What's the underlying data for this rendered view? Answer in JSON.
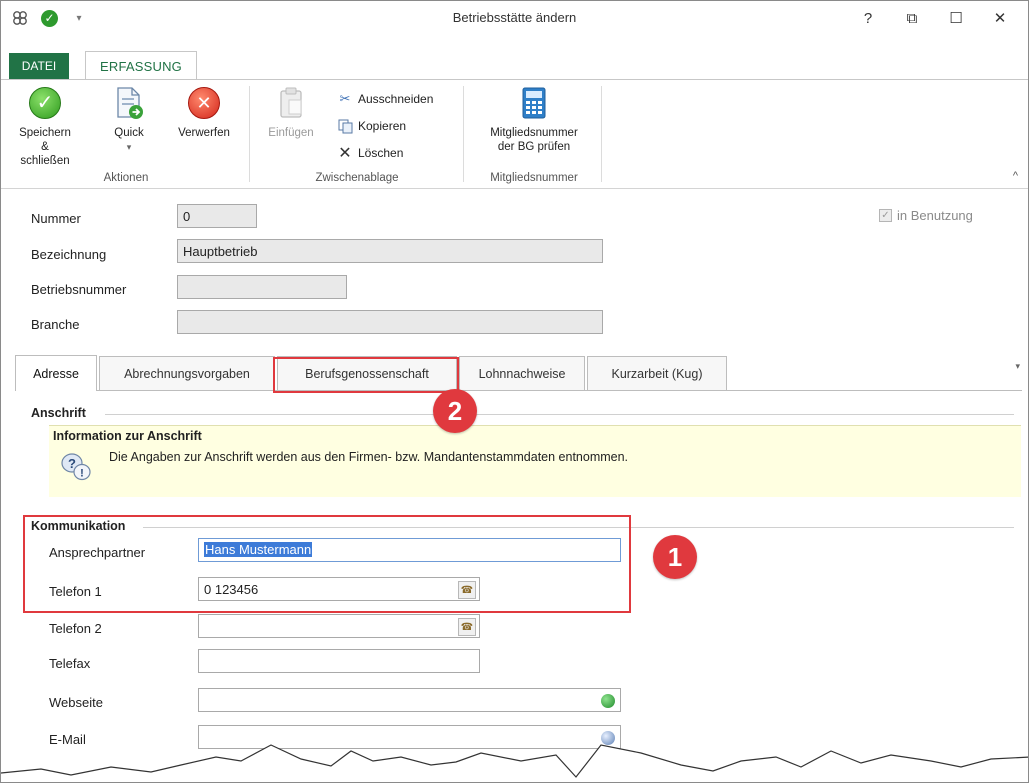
{
  "window": {
    "title": "Betriebsstätte ändern",
    "controls": {
      "help": "?",
      "restore": "⧉",
      "maximize": "☐",
      "close": "✕"
    }
  },
  "quick_access": {
    "app_icon": "app-logo-icon",
    "save_icon": "check-icon",
    "dropdown": "▾"
  },
  "ribbon": {
    "tabs": [
      {
        "label": "DATEI"
      },
      {
        "label": "ERFASSUNG"
      }
    ],
    "groups": {
      "aktionen": {
        "label": "Aktionen",
        "buttons": [
          {
            "line1": "Speichern",
            "line2": "& schließen"
          },
          {
            "line1": "Quick",
            "line2": "▾"
          },
          {
            "line1": "Verwerfen"
          }
        ]
      },
      "zwischenablage": {
        "label": "Zwischenablage",
        "paste": "Einfügen",
        "cut": "Ausschneiden",
        "copy": "Kopieren",
        "delete": "Löschen"
      },
      "mitgliedsnummer": {
        "label": "Mitgliedsnummer",
        "button_line1": "Mitgliedsnummer",
        "button_line2": "der BG prüfen"
      }
    },
    "collapse": "^"
  },
  "form": {
    "nummer": {
      "label": "Nummer",
      "value": "0"
    },
    "bezeichnung": {
      "label": "Bezeichnung",
      "value": "Hauptbetrieb"
    },
    "betriebsnummer": {
      "label": "Betriebsnummer",
      "value": ""
    },
    "branche": {
      "label": "Branche",
      "value": ""
    },
    "in_benutzung": {
      "label": "in Benutzung",
      "checked": true
    }
  },
  "tabs": [
    {
      "label": "Adresse"
    },
    {
      "label": "Abrechnungsvorgaben"
    },
    {
      "label": "Berufsgenossenschaft"
    },
    {
      "label": "Lohnnachweise"
    },
    {
      "label": "Kurzarbeit (Kug)"
    }
  ],
  "anschrift": {
    "section": "Anschrift",
    "info_title": "Information zur Anschrift",
    "info_text": "Die Angaben zur Anschrift werden aus den Firmen- bzw. Mandantenstammdaten entnommen."
  },
  "kommunikation": {
    "section": "Kommunikation",
    "ansprechpartner": {
      "label": "Ansprechpartner",
      "value": "Hans Mustermann"
    },
    "telefon1": {
      "label": "Telefon 1",
      "value": "0 123456"
    },
    "telefon2": {
      "label": "Telefon 2",
      "value": ""
    },
    "telefax": {
      "label": "Telefax",
      "value": ""
    },
    "webseite": {
      "label": "Webseite",
      "value": ""
    },
    "email": {
      "label": "E-Mail",
      "value": ""
    }
  },
  "callouts": {
    "one": "1",
    "two": "2"
  },
  "colors": {
    "accent_green": "#217346",
    "callout_red": "#e0393e",
    "info_yellow": "#ffffe1",
    "selection_blue": "#3d7bd8"
  }
}
